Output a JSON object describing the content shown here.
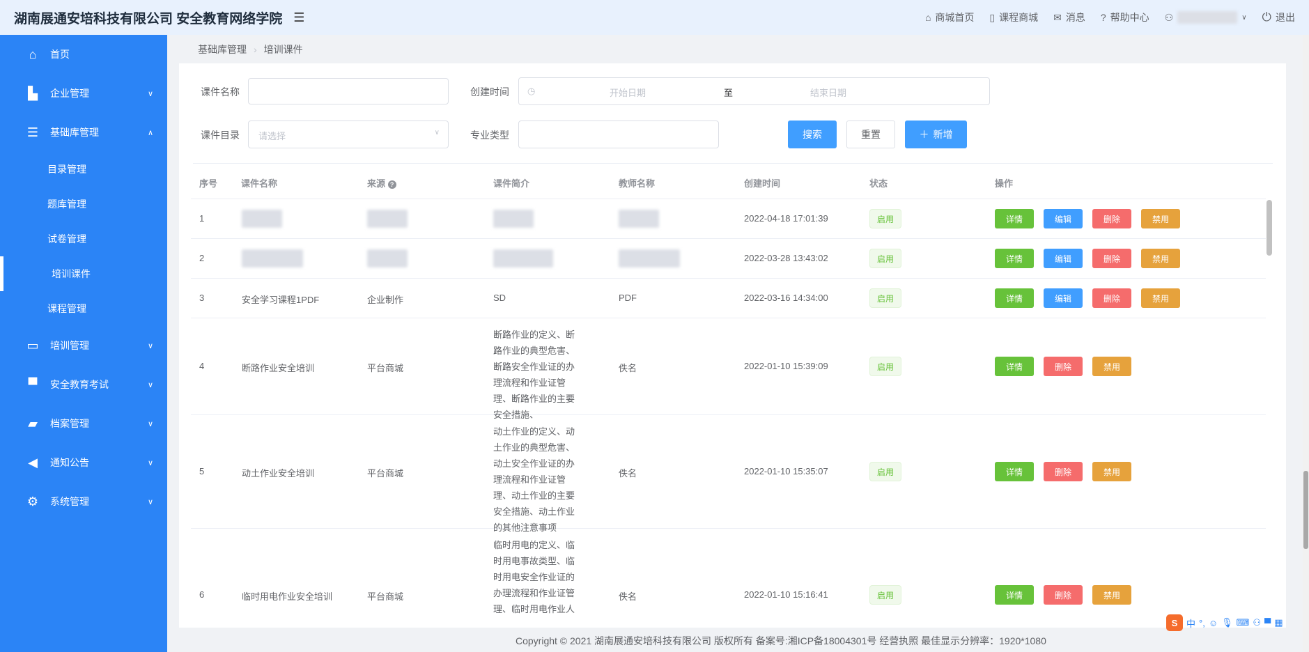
{
  "header": {
    "brand": "湖南展通安培科技有限公司 安全教育网络学院",
    "nav": [
      {
        "icon": "home-icon",
        "label": "商城首页"
      },
      {
        "icon": "book-icon",
        "label": "课程商城"
      },
      {
        "icon": "mail-icon",
        "label": "消息"
      },
      {
        "icon": "help-icon",
        "label": "帮助中心"
      }
    ],
    "logout": "退出"
  },
  "sidebar": {
    "items": [
      {
        "icon": "home-icon",
        "label": "首页"
      },
      {
        "icon": "building-icon",
        "label": "企业管理"
      },
      {
        "icon": "list-icon",
        "label": "基础库管理"
      },
      {
        "icon": "presentation-icon",
        "label": "培训管理"
      },
      {
        "icon": "shirt-icon",
        "label": "安全教育考试"
      },
      {
        "icon": "folder-icon",
        "label": "档案管理"
      },
      {
        "icon": "speaker-icon",
        "label": "通知公告"
      },
      {
        "icon": "gear-icon",
        "label": "系统管理"
      }
    ],
    "sub_items": [
      "目录管理",
      "题库管理",
      "试卷管理",
      "培训课件",
      "课程管理"
    ]
  },
  "breadcrumb": {
    "parent": "基础库管理",
    "current": "培训课件"
  },
  "filters": {
    "name_label": "课件名称",
    "created_label": "创建时间",
    "start_placeholder": "开始日期",
    "range_sep": "至",
    "end_placeholder": "结束日期",
    "catalog_label": "课件目录",
    "catalog_placeholder": "请选择",
    "major_label": "专业类型",
    "search": "搜索",
    "reset": "重置",
    "add": "新增"
  },
  "table": {
    "headers": [
      "序号",
      "课件名称",
      "来源",
      "课件简介",
      "教师名称",
      "创建时间",
      "状态",
      "操作"
    ],
    "rows": [
      {
        "no": "1",
        "name": "",
        "source": "",
        "intro": "",
        "teacher": "",
        "created": "2022-04-18 17:01:39",
        "status": "启用"
      },
      {
        "no": "2",
        "name": "",
        "source": "",
        "intro": "",
        "teacher": "",
        "created": "2022-03-28 13:43:02",
        "status": "启用"
      },
      {
        "no": "3",
        "name": "安全学习课程1PDF",
        "source": "企业制作",
        "intro": "SD",
        "teacher": "PDF",
        "created": "2022-03-16 14:34:00",
        "status": "启用"
      },
      {
        "no": "4",
        "name": "断路作业安全培训",
        "source": "平台商城",
        "intro": "断路作业的定义、断路作业的典型危害、断路安全作业证的办理流程和作业证管理、断路作业的主要安全措施、",
        "teacher": "佚名",
        "created": "2022-01-10 15:39:09",
        "status": "启用"
      },
      {
        "no": "5",
        "name": "动土作业安全培训",
        "source": "平台商城",
        "intro": "动土作业的定义、动土作业的典型危害、动土安全作业证的办理流程和作业证管理、动土作业的主要安全措施、动土作业的其他注意事项",
        "teacher": "佚名",
        "created": "2022-01-10 15:35:07",
        "status": "启用"
      },
      {
        "no": "6",
        "name": "临时用电作业安全培训",
        "source": "平台商城",
        "intro": "临时用电的定义、临时用电事故类型、临时用电安全作业证的办理流程和作业证管理、临时用电作业人员安全要求、临时用电",
        "teacher": "佚名",
        "created": "2022-01-10 15:16:41",
        "status": "启用"
      }
    ],
    "ops": {
      "detail": "详情",
      "edit": "编辑",
      "delete": "删除",
      "disable": "禁用"
    }
  },
  "footer": "Copyright © 2021 湖南展通安培科技有限公司 版权所有 备案号:湘ICP备18004301号 经营执照 最佳显示分辨率：1920*1080",
  "ime": {
    "logo": "S",
    "lang": "中"
  }
}
